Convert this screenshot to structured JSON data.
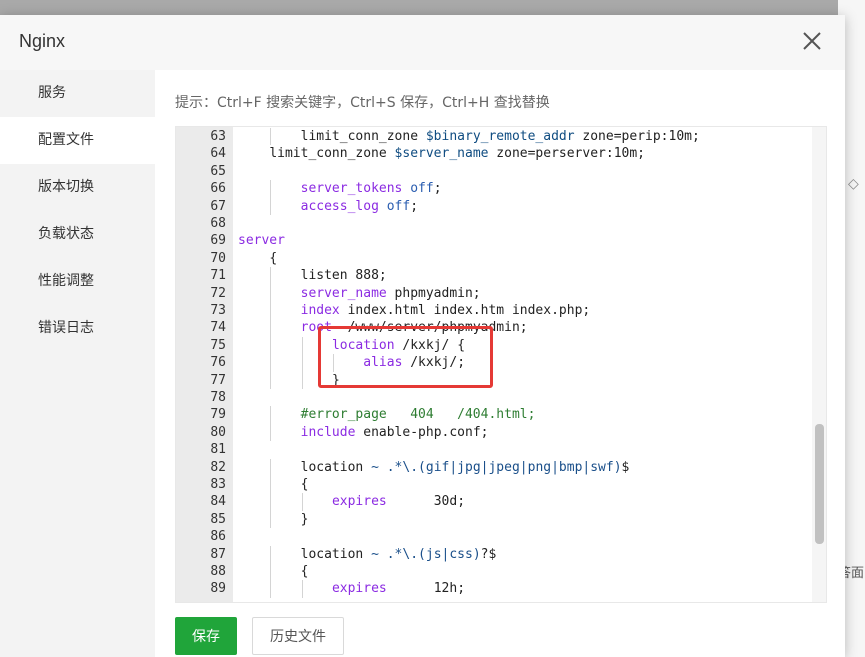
{
  "dialog": {
    "title": "Nginx",
    "close_icon": "close-icon"
  },
  "sidebar": {
    "items": [
      {
        "label": "服务",
        "active": false
      },
      {
        "label": "配置文件",
        "active": true
      },
      {
        "label": "版本切换",
        "active": false
      },
      {
        "label": "负载状态",
        "active": false
      },
      {
        "label": "性能调整",
        "active": false
      },
      {
        "label": "错误日志",
        "active": false
      }
    ]
  },
  "hint": "提示：Ctrl+F 搜索关键字，Ctrl+S 保存，Ctrl+H 查找替换",
  "editor": {
    "lines": [
      {
        "n": "63",
        "indent": 2,
        "html": "limit_conn_zone <span class='var'>$binary_remote_addr</span> zone=perip:10m;"
      },
      {
        "n": "64",
        "indent": 1,
        "html": "limit_conn_zone <span class='var'>$server_name</span> zone=perserver:10m;"
      },
      {
        "n": "65",
        "indent": 0,
        "html": ""
      },
      {
        "n": "66",
        "indent": 2,
        "html": "<span class='kw'>server_tokens</span> <span class='str'>off</span>;"
      },
      {
        "n": "67",
        "indent": 2,
        "html": "<span class='kw'>access_log</span> <span class='str'>off</span>;"
      },
      {
        "n": "68",
        "indent": 0,
        "html": ""
      },
      {
        "n": "69",
        "indent": 0,
        "html": "<span class='kw'>server</span>"
      },
      {
        "n": "70",
        "indent": 1,
        "html": "{"
      },
      {
        "n": "71",
        "indent": 2,
        "html": "listen 888;"
      },
      {
        "n": "72",
        "indent": 2,
        "html": "<span class='kw'>server_name</span> phpmyadmin;"
      },
      {
        "n": "73",
        "indent": 2,
        "html": "<span class='kw'>index</span> index.html index.htm index.php;"
      },
      {
        "n": "74",
        "indent": 2,
        "html": "<span class='kw'>root</span>  /www/server/phpmyadmin;"
      },
      {
        "n": "75",
        "indent": 3,
        "html": "<span class='kw'>location</span> /kxkj/ {"
      },
      {
        "n": "76",
        "indent": 4,
        "html": "<span class='kw'>alias</span> /kxkj/;"
      },
      {
        "n": "77",
        "indent": 3,
        "html": "}"
      },
      {
        "n": "78",
        "indent": 0,
        "html": ""
      },
      {
        "n": "79",
        "indent": 2,
        "html": "<span class='cmt'>#error_page   404   /404.html;</span>"
      },
      {
        "n": "80",
        "indent": 2,
        "html": "<span class='kw'>include</span> enable-php.conf;"
      },
      {
        "n": "81",
        "indent": 0,
        "html": ""
      },
      {
        "n": "82",
        "indent": 2,
        "html": "location <span class='re'>~ .*\\.(gif|jpg|jpeg|png|bmp|swf)</span>$"
      },
      {
        "n": "83",
        "indent": 2,
        "html": "{"
      },
      {
        "n": "84",
        "indent": 3,
        "html": "<span class='kw'>expires</span>      30d;"
      },
      {
        "n": "85",
        "indent": 2,
        "html": "}"
      },
      {
        "n": "86",
        "indent": 0,
        "html": ""
      },
      {
        "n": "87",
        "indent": 2,
        "html": "location <span class='re'>~ .*\\.(js|css)</span>?$"
      },
      {
        "n": "88",
        "indent": 2,
        "html": "{"
      },
      {
        "n": "89",
        "indent": 3,
        "html": "<span class='kw'>expires</span>      12h;"
      }
    ]
  },
  "buttons": {
    "save": "保存",
    "history": "历史文件"
  },
  "background": {
    "right_text": "答面",
    "right_icon": "tag-icon"
  },
  "colors": {
    "accent": "#20a53a",
    "highlight": "#e53935"
  }
}
